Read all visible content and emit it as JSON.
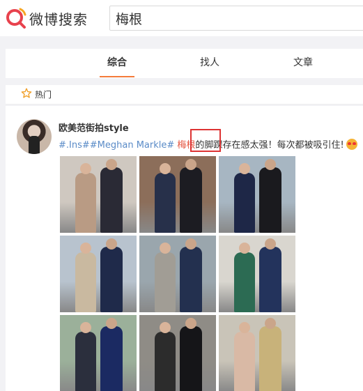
{
  "header": {
    "brand": "微博搜索",
    "search_value": "梅根"
  },
  "tabs": [
    {
      "label": "综合",
      "active": true
    },
    {
      "label": "找人",
      "active": false
    },
    {
      "label": "文章",
      "active": false
    }
  ],
  "hot_filter": {
    "label": "热门"
  },
  "post": {
    "author": "欧美范街拍style",
    "tag1": "#.Ins##Meghan Markle#",
    "highlight": "梅根",
    "text_a": "的",
    "text_b": "脚踝",
    "text_c": "存在感太强！每次都被吸引住!",
    "images": [
      {
        "bg": "#cfc8c0",
        "dark": "#2a2a35",
        "light": "#b99b84"
      },
      {
        "bg": "#8c6e5a",
        "dark": "#1c1c22",
        "light": "#27304a"
      },
      {
        "bg": "#a7b6c2",
        "dark": "#1a1a1e",
        "light": "#1e2747"
      },
      {
        "bg": "#b8c3ce",
        "dark": "#1f2a4a",
        "light": "#c9b9a0"
      },
      {
        "bg": "#9aa6ad",
        "dark": "#23304f",
        "light": "#a19d95"
      },
      {
        "bg": "#d9d6cf",
        "dark": "#23335c",
        "light": "#2c6b53"
      },
      {
        "bg": "#9bb09a",
        "dark": "#1b2a62",
        "light": "#2b2f3d"
      },
      {
        "bg": "#8f8c86",
        "dark": "#151518",
        "light": "#2c2c2c"
      },
      {
        "bg": "#c9c4b8",
        "dark": "#c8b27a",
        "light": "#d9b9a5"
      }
    ]
  }
}
